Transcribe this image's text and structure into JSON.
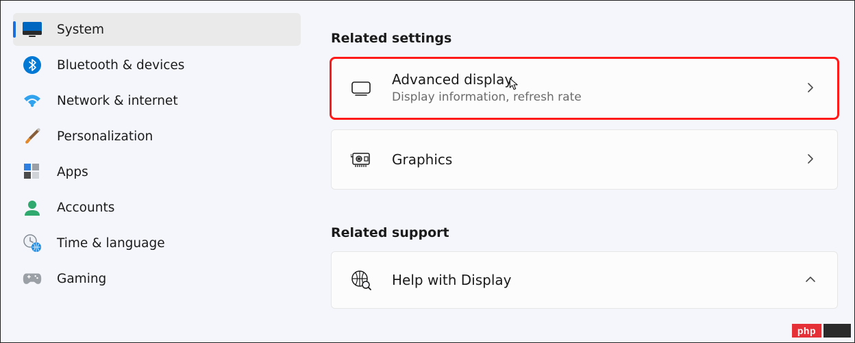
{
  "sidebar": {
    "items": [
      {
        "label": "System"
      },
      {
        "label": "Bluetooth & devices"
      },
      {
        "label": "Network & internet"
      },
      {
        "label": "Personalization"
      },
      {
        "label": "Apps"
      },
      {
        "label": "Accounts"
      },
      {
        "label": "Time & language"
      },
      {
        "label": "Gaming"
      }
    ]
  },
  "main": {
    "related_settings_header": "Related settings",
    "related_support_header": "Related support",
    "cards": {
      "advanced": {
        "title": "Advanced display",
        "subtitle": "Display information, refresh rate"
      },
      "graphics": {
        "title": "Graphics"
      },
      "help": {
        "title": "Help with Display"
      }
    }
  },
  "badge": {
    "text": "php"
  }
}
